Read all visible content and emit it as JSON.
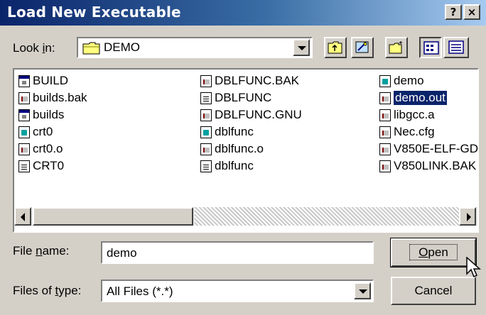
{
  "window": {
    "title": "Load New Executable",
    "help_button": "?",
    "close_button": "×"
  },
  "lookin": {
    "label_prefix": "Look ",
    "label_accel": "i",
    "label_suffix": "n:",
    "value": "DEMO",
    "icon": "folder-icon"
  },
  "toolbar": {
    "up_folder_icon": "up-one-level-icon",
    "desktop_icon": "desktop-icon",
    "new_folder_icon": "new-folder-icon",
    "list_view_icon": "list-view-icon",
    "details_view_icon": "details-view-icon"
  },
  "files": [
    {
      "name": "BUILD",
      "icon": "app"
    },
    {
      "name": "builds.bak",
      "icon": "gen"
    },
    {
      "name": "builds",
      "icon": "app"
    },
    {
      "name": "crt0",
      "icon": "src"
    },
    {
      "name": "crt0.o",
      "icon": "gen"
    },
    {
      "name": "CRT0",
      "icon": "doc"
    },
    {
      "name": "DBLFUNC.BAK",
      "icon": "gen"
    },
    {
      "name": "DBLFUNC",
      "icon": "doc"
    },
    {
      "name": "DBLFUNC.GNU",
      "icon": "gen"
    },
    {
      "name": "dblfunc",
      "icon": "src"
    },
    {
      "name": "dblfunc.o",
      "icon": "gen"
    },
    {
      "name": "dblfunc",
      "icon": "doc"
    },
    {
      "name": "demo",
      "icon": "src"
    },
    {
      "name": "demo.out",
      "icon": "gen",
      "selected": true
    },
    {
      "name": "libgcc.a",
      "icon": "gen"
    },
    {
      "name": "Nec.cfg",
      "icon": "gen"
    },
    {
      "name": "V850E-ELF-GD",
      "icon": "gen"
    },
    {
      "name": "V850LINK.BAK",
      "icon": "gen"
    }
  ],
  "filename": {
    "label_prefix": "File ",
    "label_accel": "n",
    "label_suffix": "ame:",
    "value": "demo"
  },
  "filetype": {
    "label_prefix": "Files of ",
    "label_accel": "t",
    "label_suffix": "ype:",
    "value": "All Files (*.*)"
  },
  "buttons": {
    "open_accel": "O",
    "open_rest": "pen",
    "cancel": "Cancel"
  },
  "colors": {
    "titlebar": "#0a246a",
    "selection": "#0a246a",
    "face": "#d4d0c8"
  }
}
